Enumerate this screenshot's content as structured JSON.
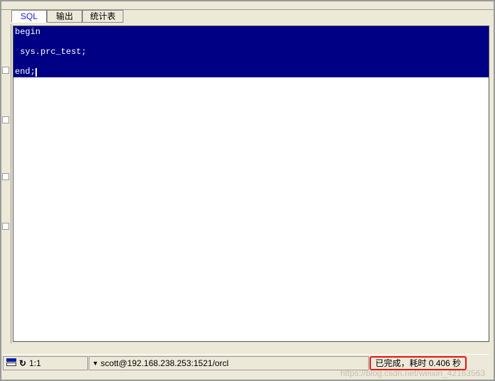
{
  "tabs": [
    {
      "label": "SQL",
      "active": true
    },
    {
      "label": "输出",
      "active": false
    },
    {
      "label": "统计表",
      "active": false
    }
  ],
  "editor": {
    "line1": "begin",
    "line2": "",
    "line3": " sys.prc_test;",
    "line4": "",
    "line5": "end;"
  },
  "statusbar": {
    "cursor_pos": "1:1",
    "connection": "scott@192.168.238.253:1521/orcl",
    "done_text": "已完成，耗时 0.406 秒"
  },
  "watermark": "https://blog.csdn.net/weixin_42163563"
}
